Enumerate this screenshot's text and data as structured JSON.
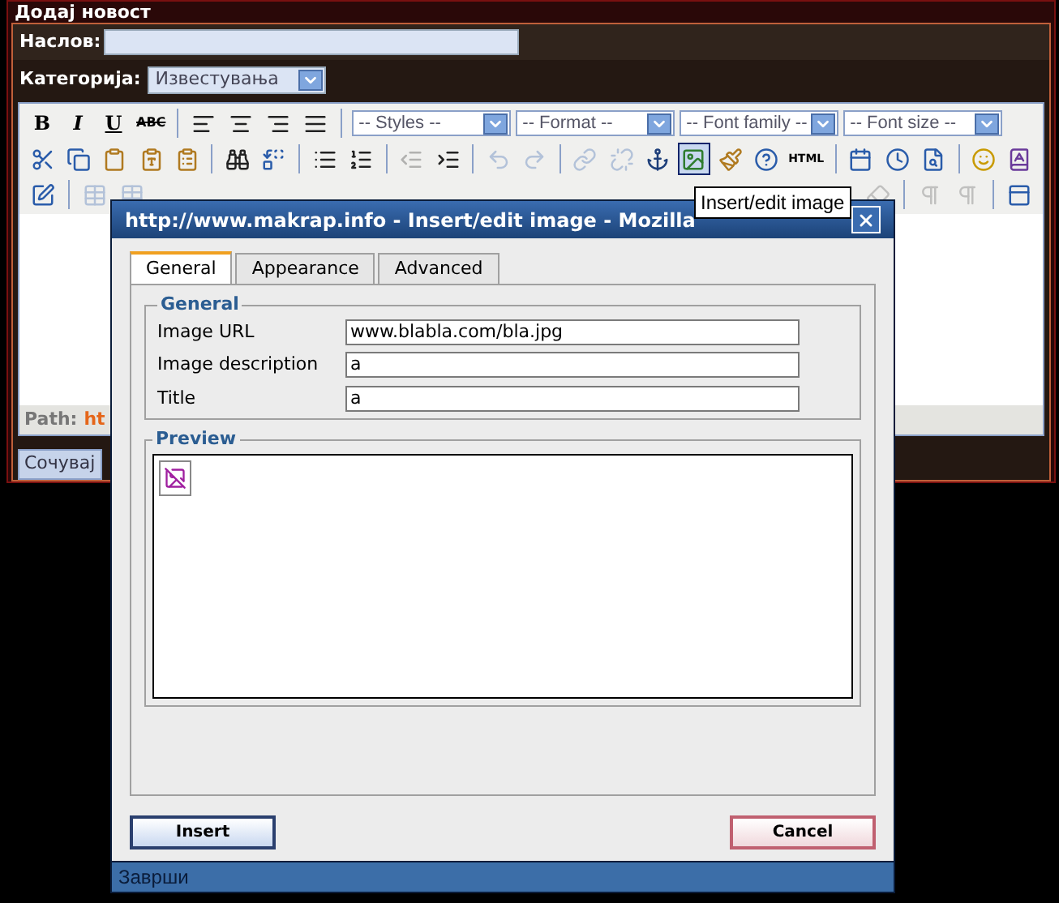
{
  "page_title": "Додај новост",
  "form": {
    "title_label": "Наслов:",
    "category_label": "Категорија:",
    "category_value": "Известувања"
  },
  "editor": {
    "toolbar_rows": [
      [
        {
          "kind": "text",
          "label": "B"
        },
        {
          "kind": "text",
          "label": "I"
        },
        {
          "kind": "text",
          "label": "U"
        },
        {
          "kind": "text",
          "label": "ABC"
        },
        {
          "kind": "sep"
        },
        {
          "kind": "icon",
          "disabled": false,
          "selected": false
        },
        {
          "kind": "icon",
          "disabled": false,
          "selected": false
        },
        {
          "kind": "icon",
          "disabled": false,
          "selected": false
        },
        {
          "kind": "icon",
          "disabled": false,
          "selected": false
        },
        {
          "kind": "sep"
        },
        {
          "kind": "select",
          "placeholder": "-- Styles --"
        },
        {
          "kind": "select",
          "placeholder": "-- Format --"
        },
        {
          "kind": "select",
          "placeholder": "-- Font family --"
        },
        {
          "kind": "select",
          "placeholder": "-- Font size --"
        }
      ],
      [
        {
          "kind": "icon",
          "disabled": false,
          "selected": false
        },
        {
          "kind": "icon",
          "disabled": false,
          "selected": false
        },
        {
          "kind": "icon",
          "disabled": false,
          "selected": false
        },
        {
          "kind": "icon",
          "disabled": false,
          "selected": false
        },
        {
          "kind": "icon",
          "disabled": false,
          "selected": false
        },
        {
          "kind": "sep"
        },
        {
          "kind": "icon",
          "disabled": false,
          "selected": false
        },
        {
          "kind": "icon",
          "disabled": false,
          "selected": false
        },
        {
          "kind": "sep"
        },
        {
          "kind": "icon",
          "disabled": false,
          "selected": false
        },
        {
          "kind": "icon",
          "disabled": false,
          "selected": false
        },
        {
          "kind": "sep"
        },
        {
          "kind": "icon",
          "disabled": true,
          "selected": false
        },
        {
          "kind": "icon",
          "disabled": false,
          "selected": false
        },
        {
          "kind": "sep"
        },
        {
          "kind": "icon",
          "disabled": true,
          "selected": false
        },
        {
          "kind": "icon",
          "disabled": true,
          "selected": false
        },
        {
          "kind": "sep"
        },
        {
          "kind": "icon",
          "disabled": true,
          "selected": false
        },
        {
          "kind": "icon",
          "disabled": true,
          "selected": false
        },
        {
          "kind": "icon",
          "disabled": false,
          "selected": false
        },
        {
          "kind": "icon",
          "disabled": false,
          "selected": true
        },
        {
          "kind": "icon",
          "disabled": false,
          "selected": false
        },
        {
          "kind": "icon",
          "disabled": false,
          "selected": false
        },
        {
          "kind": "text",
          "label": "HTML"
        },
        {
          "kind": "sep"
        },
        {
          "kind": "icon",
          "disabled": false,
          "selected": false
        },
        {
          "kind": "icon",
          "disabled": false,
          "selected": false
        },
        {
          "kind": "icon",
          "disabled": false,
          "selected": false
        },
        {
          "kind": "sep"
        },
        {
          "kind": "icon",
          "disabled": false,
          "selected": false
        },
        {
          "kind": "icon",
          "disabled": false,
          "selected": false
        }
      ],
      [
        {
          "kind": "icon",
          "disabled": false,
          "selected": false
        },
        {
          "kind": "sep"
        },
        {
          "kind": "icon",
          "disabled": true,
          "selected": false
        },
        {
          "kind": "icon",
          "disabled": true,
          "selected": false
        },
        {
          "kind": "spacer"
        },
        {
          "kind": "icon",
          "disabled": true,
          "selected": false
        },
        {
          "kind": "sep"
        },
        {
          "kind": "icon",
          "disabled": true,
          "selected": false
        },
        {
          "kind": "icon",
          "disabled": true,
          "selected": false
        },
        {
          "kind": "sep"
        },
        {
          "kind": "icon",
          "disabled": false,
          "selected": false
        }
      ]
    ],
    "path_label": "Path:",
    "path_value": "ht"
  },
  "save_button": "Сочувај",
  "tooltip": "Insert/edit image",
  "dialog": {
    "title": "http://www.makrap.info - Insert/edit image - Mozilla",
    "tabs": [
      {
        "label": "General",
        "selected": true
      },
      {
        "label": "Appearance",
        "selected": false
      },
      {
        "label": "Advanced",
        "selected": false
      }
    ],
    "general": {
      "legend": "General",
      "fields": [
        {
          "label": "Image URL",
          "value": "www.blabla.com/bla.jpg"
        },
        {
          "label": "Image description",
          "value": "a"
        },
        {
          "label": "Title",
          "value": "a"
        }
      ]
    },
    "preview": {
      "legend": "Preview"
    },
    "insert_button": "Insert",
    "cancel_button": "Cancel",
    "status": "Заврши"
  }
}
